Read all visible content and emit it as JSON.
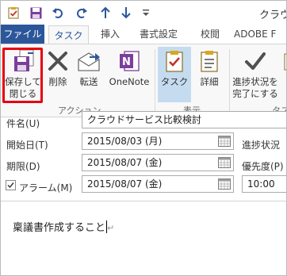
{
  "window": {
    "title": "クラウ"
  },
  "quick_access": [
    "save-icon",
    "undo-icon",
    "redo-icon",
    "up-arrow-icon",
    "down-arrow-icon"
  ],
  "tabs": [
    "ファイル",
    "タスク",
    "挿入",
    "書式設定",
    "校閲",
    "ADOBE F"
  ],
  "active_tab": "タスク",
  "ribbon": {
    "save_close_line1": "保存して",
    "save_close_line2": "閉じる",
    "delete": "削除",
    "forward": "転送",
    "onenote": "OneNote",
    "task": "タスク",
    "details": "詳細",
    "complete_line1": "進捗状況を",
    "complete_line2": "完了にする",
    "group_actions": "アクション",
    "group_show": "表示",
    "group_tasks": "タス"
  },
  "form": {
    "subject_label": "件名(U)",
    "subject_value": "クラウドサービス比較検討",
    "start_label": "開始日(T)",
    "start_value": "2015/08/03 (月)",
    "status_label": "進捗状況",
    "due_label": "期限(D)",
    "due_value": "2015/08/07 (金)",
    "priority_label": "優先度(P)",
    "alarm_label": "アラーム(M)",
    "alarm_date": "2015/08/07 (金)",
    "alarm_time": "10:00",
    "alarm_checked": true
  },
  "body": {
    "text": "稟議書作成すること"
  },
  "colors": {
    "file_tab": "#2b579a",
    "highlight": "#e60012",
    "selected_button": "#c5dbf0"
  }
}
